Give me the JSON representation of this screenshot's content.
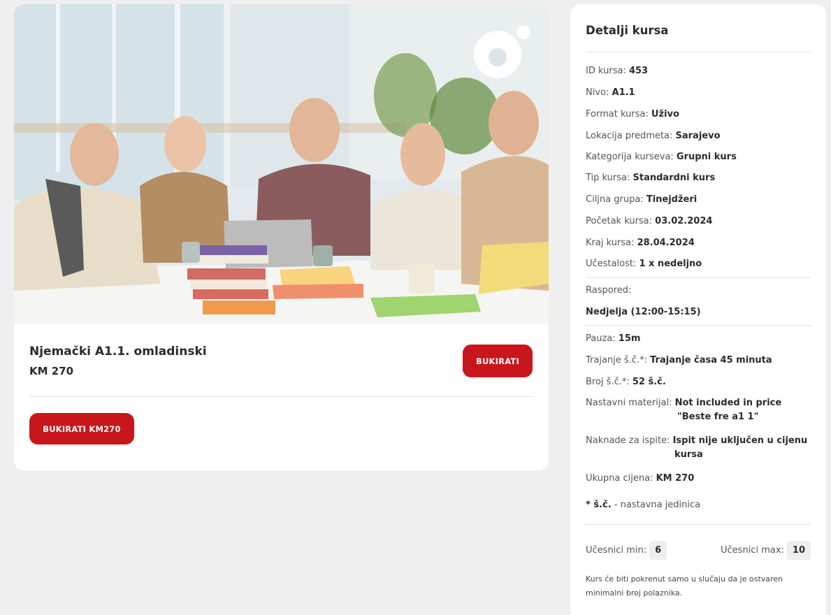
{
  "course": {
    "title": "Njemački A1.1. omladinski",
    "price": "KM 270",
    "book_button": "BUKIRATI",
    "book_price_button": "BUKIRATI KM270"
  },
  "details": {
    "heading": "Detalji kursa",
    "rows": [
      {
        "label": "ID kursa:",
        "value": "453"
      },
      {
        "label": "Nivo:",
        "value": "A1.1"
      },
      {
        "label": "Format kursa:",
        "value": "Uživo"
      },
      {
        "label": "Lokacija predmeta:",
        "value": "Sarajevo"
      },
      {
        "label": "Kategorija kurseva:",
        "value": "Grupni kurs"
      },
      {
        "label": "Tip kursa:",
        "value": "Standardni kurs"
      },
      {
        "label": "Ciljna grupa:",
        "value": "Tinejdžeri"
      },
      {
        "label": "Početak kursa:",
        "value": "03.02.2024"
      },
      {
        "label": "Kraj kursa:",
        "value": "28.04.2024"
      },
      {
        "label": "Učestalost:",
        "value": "1 x nedeljno"
      }
    ],
    "schedule_label": "Raspored:",
    "schedule_value": "Nedjelja (12:00-15:15)",
    "rows2": [
      {
        "label": "Pauza:",
        "value": "15m"
      },
      {
        "label": "Trajanje š.č.*:",
        "value": "Trajanje časa 45 minuta"
      },
      {
        "label": "Broj š.č.*:",
        "value": "52 š.č."
      }
    ],
    "material_label": "Nastavni materijal:",
    "material_value_1": "Not included in price",
    "material_value_2": "\"Beste fre a1 1\"",
    "exam_label": "Naknade za ispite:",
    "exam_value_1": "Ispit nije uključen u cijenu",
    "exam_value_2": "kursa",
    "total_label": "Ukupna cijena:",
    "total_value": "KM 270",
    "footnote_mark": "* š.č.",
    "footnote_text": " - nastavna jedinica",
    "min_label": "Učesnici min:",
    "min_value": "6",
    "max_label": "Učesnici max:",
    "max_value": "10",
    "note": "Kurs će biti pokrenut samo u slučaju da je ostvaren minimalni broj polaznika."
  },
  "colors": {
    "accent": "#c8161d",
    "background": "#efefef",
    "card": "#ffffff"
  },
  "icons": {
    "brand_logo": "circle-logo-icon"
  }
}
